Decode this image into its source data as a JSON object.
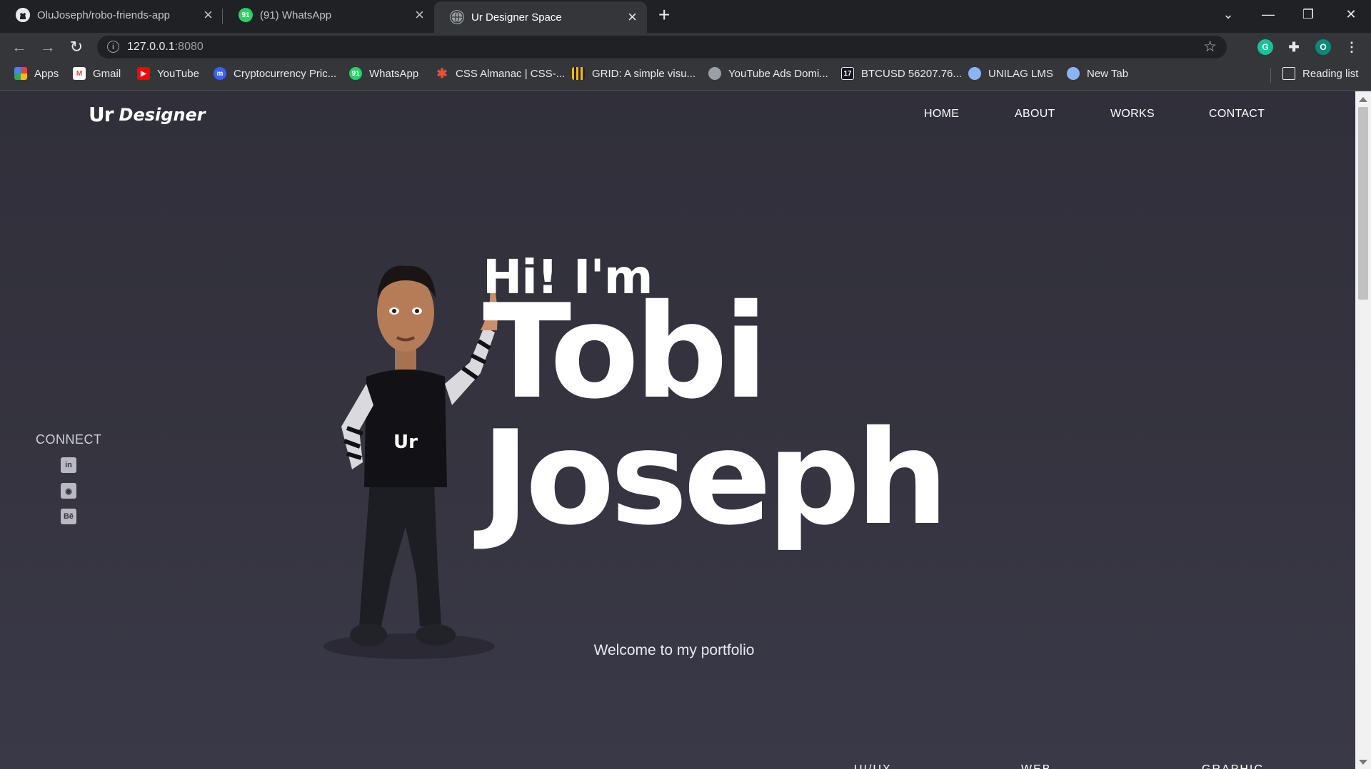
{
  "browser": {
    "tabs": [
      {
        "title": "OluJoseph/robo-friends-app",
        "favicon": "github-icon",
        "active": false
      },
      {
        "title": "(91) WhatsApp",
        "favicon": "whatsapp-icon",
        "active": false
      },
      {
        "title": "Ur Designer Space",
        "favicon": "globe-icon",
        "active": true
      }
    ],
    "url_host": "127.0.0.1",
    "url_port": ":8080",
    "profile_initial": "O",
    "whatsapp_badge": "91",
    "bookmarks": [
      {
        "label": "Apps",
        "icon": "apps-grid-icon",
        "color": "#ea4335"
      },
      {
        "label": "Gmail",
        "icon": "gmail-icon",
        "color": "#ea4335"
      },
      {
        "label": "YouTube",
        "icon": "youtube-icon",
        "color": "#ff0000"
      },
      {
        "label": "Cryptocurrency Pric...",
        "icon": "coinmarketcap-icon",
        "color": "#3861fb"
      },
      {
        "label": "WhatsApp",
        "icon": "whatsapp-icon",
        "color": "#25d366"
      },
      {
        "label": "CSS Almanac | CSS-...",
        "icon": "css-tricks-icon",
        "color": "#e8523a"
      },
      {
        "label": "GRID: A simple visu...",
        "icon": "grid-icon",
        "color": "#202124"
      },
      {
        "label": "YouTube Ads Domi...",
        "icon": "youtube-ads-icon",
        "color": "#5f6368"
      },
      {
        "label": "BTCUSD 56207.76...",
        "icon": "tradingview-icon",
        "color": "#131722"
      },
      {
        "label": "UNILAG LMS",
        "icon": "unilag-icon",
        "color": "#8ab4f8"
      },
      {
        "label": "New Tab",
        "icon": "newtab-icon",
        "color": "#8ab4f8"
      }
    ],
    "reading_list": "Reading list"
  },
  "site": {
    "logo_mark": "Ur",
    "logo_word": "Designer",
    "nav": [
      "HOME",
      "ABOUT",
      "WORKS",
      "CONTACT"
    ],
    "connect_label": "CONNECT",
    "social": [
      {
        "name": "linkedin-icon",
        "glyph": "in"
      },
      {
        "name": "github-icon",
        "glyph": "◉"
      },
      {
        "name": "behance-icon",
        "glyph": "Bē"
      }
    ],
    "hero_greeting": "Hi! I'm",
    "hero_first_name": "Tobi",
    "hero_last_name": "Joseph",
    "shirt_logo": "Ur",
    "welcome": "Welcome to my portfolio",
    "services_peek": [
      "UI/UX",
      "WEB",
      "GRAPHIC"
    ]
  },
  "colors": {
    "page_bg": "#35343f",
    "chrome_dark": "#202124",
    "chrome": "#35363a",
    "accent_profile": "#0b8a77"
  }
}
